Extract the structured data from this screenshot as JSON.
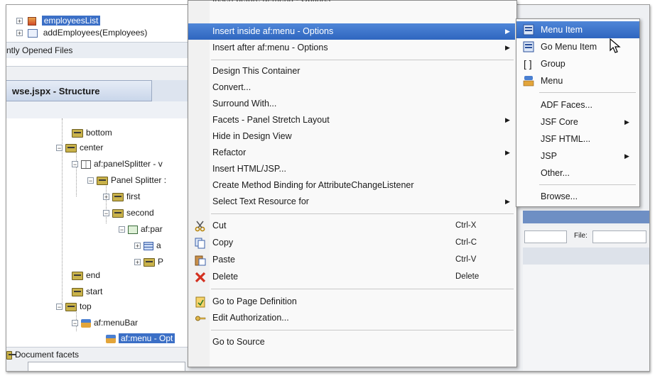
{
  "top_panel": {
    "items": [
      {
        "label": "employeesList",
        "selected": true
      },
      {
        "label": "addEmployees(Employees)",
        "selected": false
      }
    ],
    "recent_files_label": "ntly Opened Files"
  },
  "structure_panel": {
    "tab_title": "wse.jspx - Structure",
    "tree": [
      {
        "label": "bottom",
        "icon": "facet-folder-icon"
      },
      {
        "label": "center",
        "icon": "facet-folder-icon"
      },
      {
        "label": "af:panelSplitter - v",
        "icon": "panel-splitter-icon"
      },
      {
        "label": "Panel Splitter :",
        "icon": "facet-folder-icon"
      },
      {
        "label": "first",
        "icon": "facet-folder-icon"
      },
      {
        "label": "second",
        "icon": "facet-folder-icon"
      },
      {
        "label": "af:par",
        "icon": "panel-icon"
      },
      {
        "label": "a",
        "icon": "table-icon"
      },
      {
        "label": "P",
        "icon": "facet-folder-icon"
      },
      {
        "label": "end",
        "icon": "facet-folder-icon"
      },
      {
        "label": "start",
        "icon": "facet-folder-icon"
      },
      {
        "label": "top",
        "icon": "facet-folder-icon"
      },
      {
        "label": "af:menuBar",
        "icon": "menu-bar-icon"
      },
      {
        "label": "af:menu - Opt",
        "icon": "menu-icon",
        "selected": true
      }
    ],
    "document_facets_label": "Document facets"
  },
  "context_menu": {
    "items": [
      {
        "label": "Insert inside af:menu - Options",
        "submenu": true,
        "highlighted": true
      },
      {
        "label": "Insert after af:menu - Options",
        "submenu": true
      },
      {
        "label": "Design This Container"
      },
      {
        "label": "Convert..."
      },
      {
        "label": "Surround With..."
      },
      {
        "label": "Facets - Panel Stretch Layout",
        "submenu": true
      },
      {
        "label": "Hide in Design View"
      },
      {
        "label": "Refactor",
        "submenu": true
      },
      {
        "label": "Insert HTML/JSP..."
      },
      {
        "label": "Create Method Binding for AttributeChangeListener"
      },
      {
        "label": "Select Text Resource for",
        "submenu": true
      },
      {
        "label": "Cut",
        "shortcut": "Ctrl-X",
        "icon": "scissors-icon"
      },
      {
        "label": "Copy",
        "shortcut": "Ctrl-C",
        "icon": "copy-icon"
      },
      {
        "label": "Paste",
        "shortcut": "Ctrl-V",
        "icon": "paste-icon"
      },
      {
        "label": "Delete",
        "shortcut": "Delete",
        "icon": "delete-x-icon"
      },
      {
        "label": "Go to Page Definition",
        "icon": "page-definition-icon"
      },
      {
        "label": "Edit Authorization...",
        "icon": "key-icon"
      },
      {
        "label": "Go to Source"
      }
    ]
  },
  "submenu": {
    "items": [
      {
        "label": "Menu Item",
        "highlighted": true,
        "icon": "menu-item-icon"
      },
      {
        "label": "Go Menu Item",
        "icon": "go-menu-item-icon"
      },
      {
        "label": "Group",
        "icon": "group-bracket-icon"
      },
      {
        "label": "Menu",
        "icon": "menu-icon"
      },
      {
        "label": "ADF Faces..."
      },
      {
        "label": "JSF Core",
        "submenu": true
      },
      {
        "label": "JSF HTML..."
      },
      {
        "label": "JSP",
        "submenu": true
      },
      {
        "label": "Other..."
      },
      {
        "label": "Browse..."
      }
    ]
  },
  "right_panel": {
    "file_label": "File:"
  },
  "colors": {
    "highlight": "#2f66bf",
    "selection": "#3b6fc6"
  }
}
